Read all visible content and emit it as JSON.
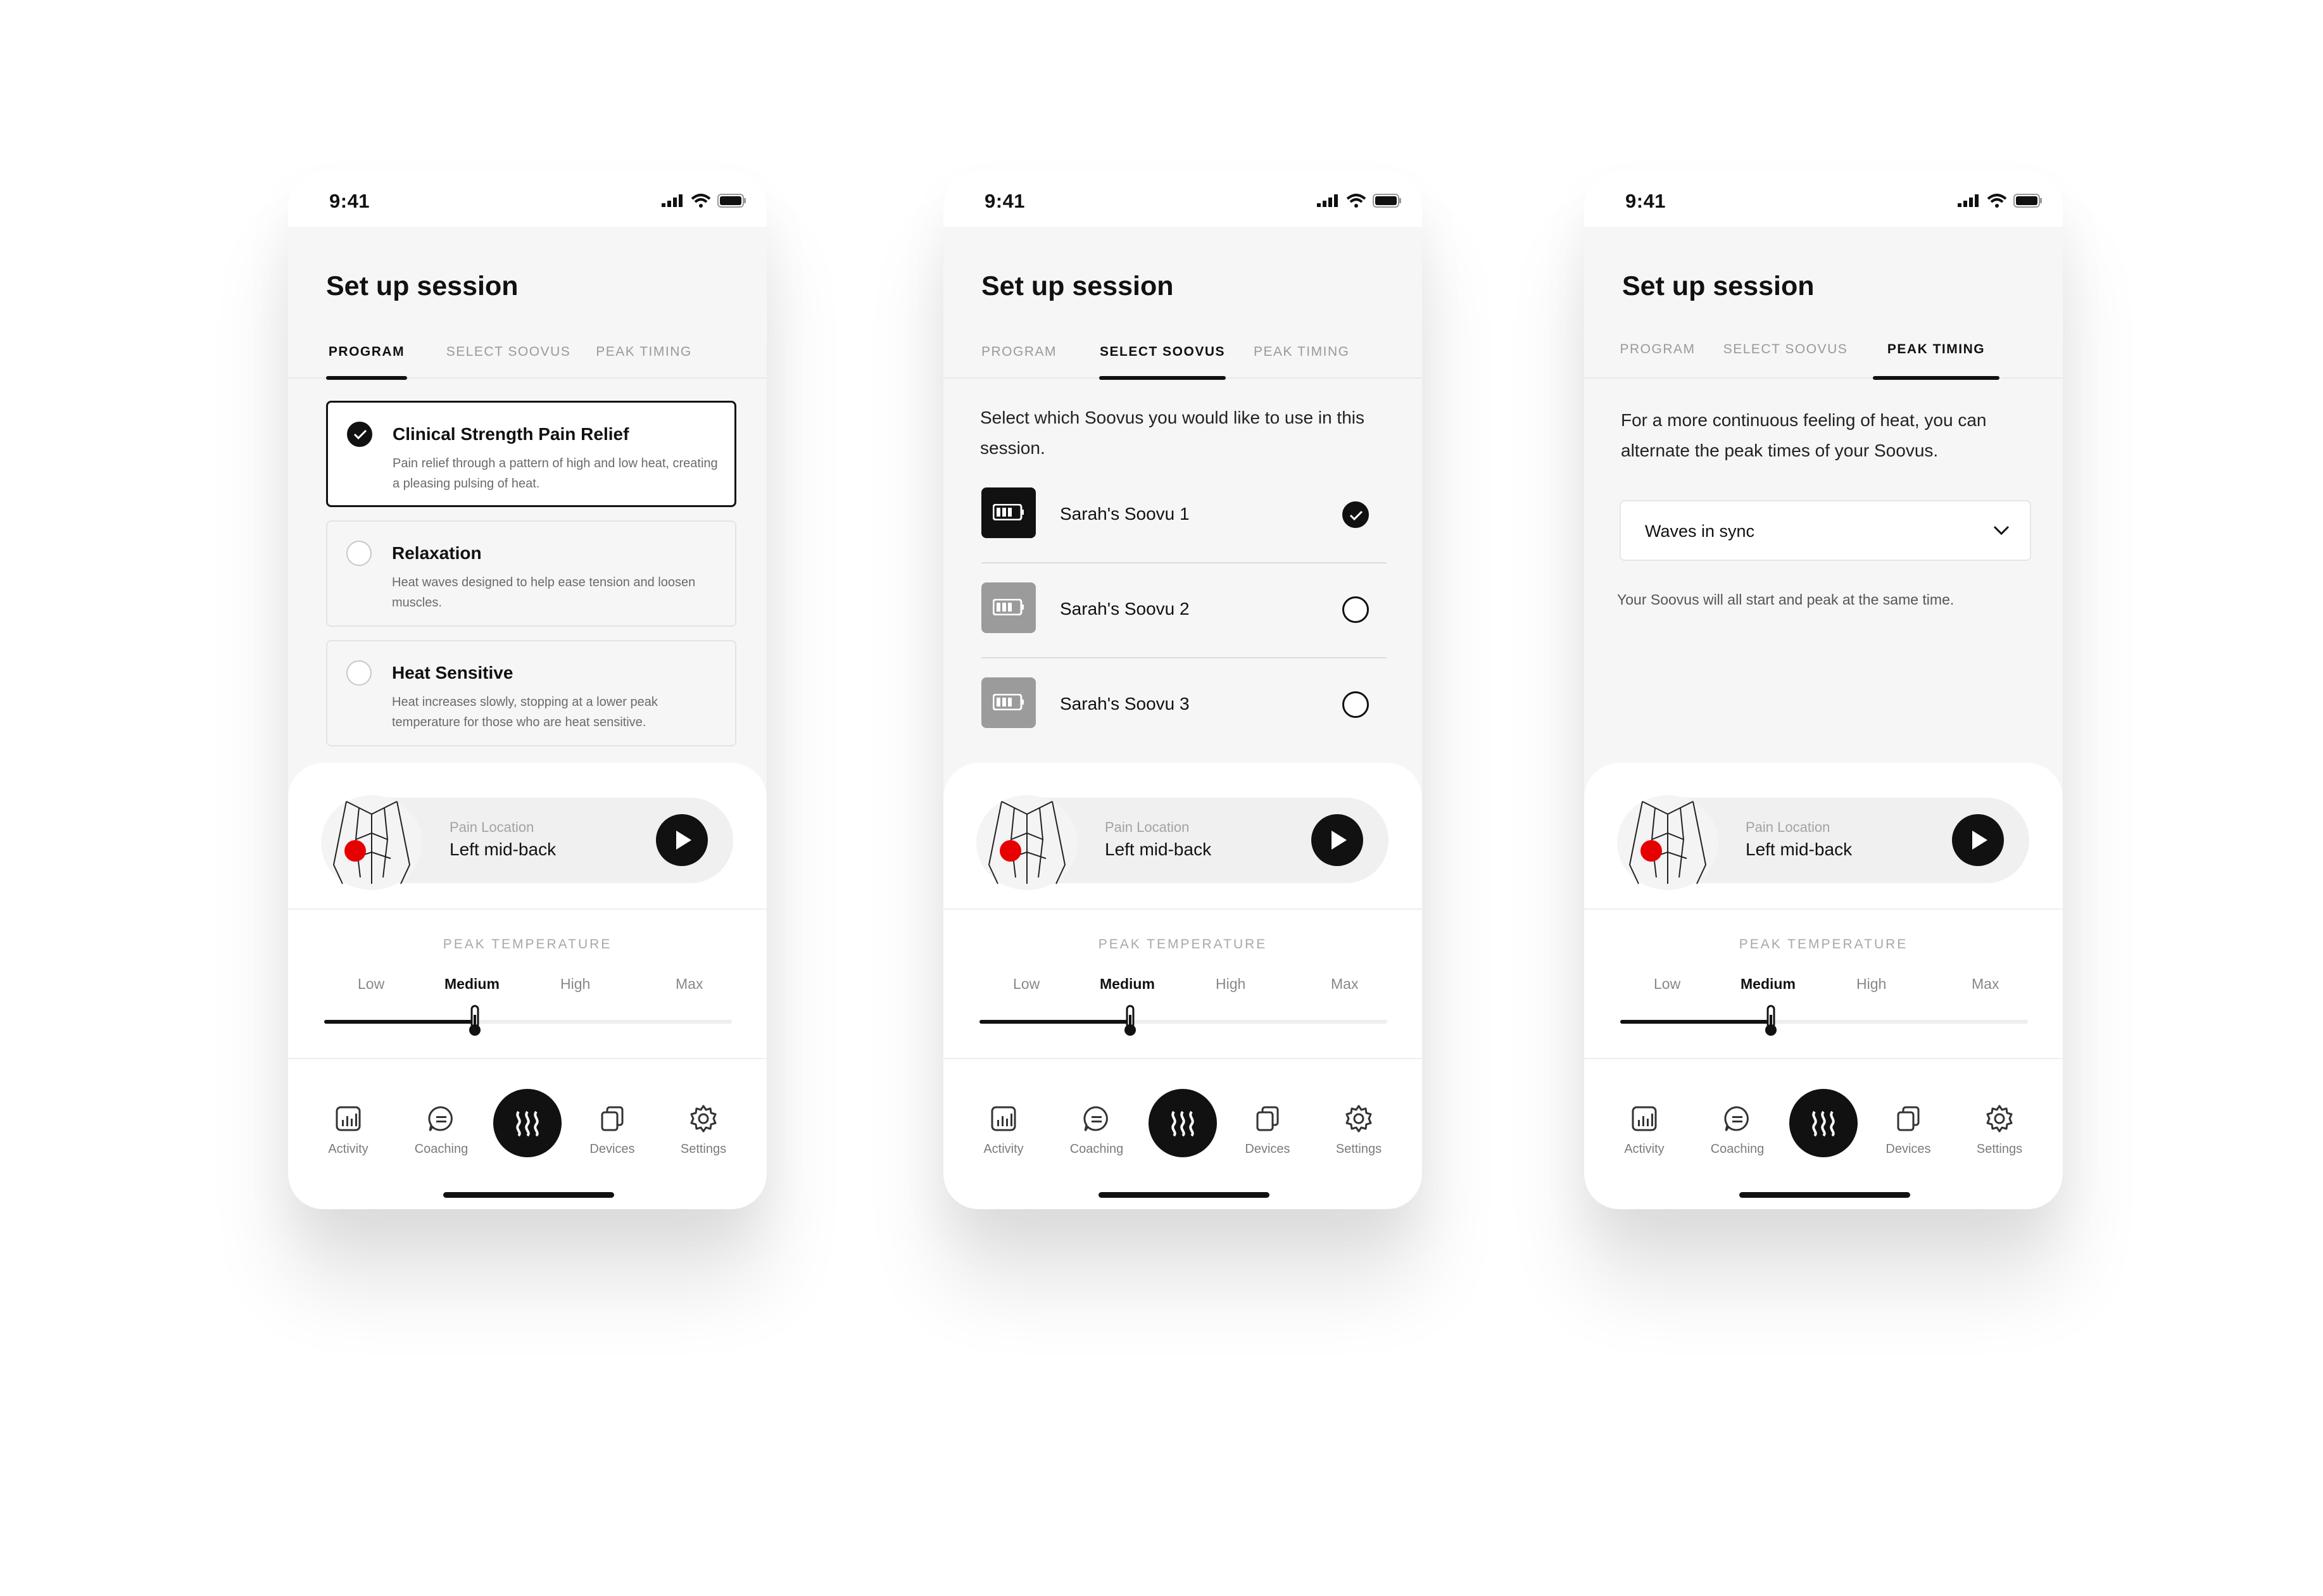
{
  "status": {
    "time": "9:41"
  },
  "screen_title": "Set up session",
  "tabs": [
    "PROGRAM",
    "SELECT SOOVUS",
    "PEAK TIMING"
  ],
  "programs": [
    {
      "title": "Clinical Strength Pain Relief",
      "desc": "Pain relief through a pattern of high and low heat, creating a pleasing pulsing of heat.",
      "selected": true
    },
    {
      "title": "Relaxation",
      "desc": "Heat waves designed to help ease tension and loosen muscles.",
      "selected": false
    },
    {
      "title": "Heat Sensitive",
      "desc": "Heat increases slowly, stopping at a lower peak temperature for those who are heat sensitive.",
      "selected": false
    }
  ],
  "select_soovus": {
    "intro": "Select which Soovus you would like to use in this session.",
    "devices": [
      {
        "name": "Sarah's Soovu 1",
        "selected": true
      },
      {
        "name": "Sarah's Soovu 2",
        "selected": false
      },
      {
        "name": "Sarah's Soovu 3",
        "selected": false
      }
    ]
  },
  "peak_timing": {
    "intro": "For a more continuous feeling of heat, you can alternate the peak times of your Soovus.",
    "dropdown_value": "Waves in sync",
    "hint": "Your Soovus will all start and peak at the same time."
  },
  "pain": {
    "label": "Pain Location",
    "value": "Left mid-back"
  },
  "temperature": {
    "title": "PEAK TEMPERATURE",
    "levels": [
      "Low",
      "Medium",
      "High",
      "Max"
    ],
    "selected": "Medium",
    "value_fraction": 0.37
  },
  "nav": [
    "Activity",
    "Coaching",
    "Devices",
    "Settings"
  ],
  "colors": {
    "accent": "#111111",
    "pain_marker": "#e60000",
    "inactive": "#9a9a9a"
  }
}
